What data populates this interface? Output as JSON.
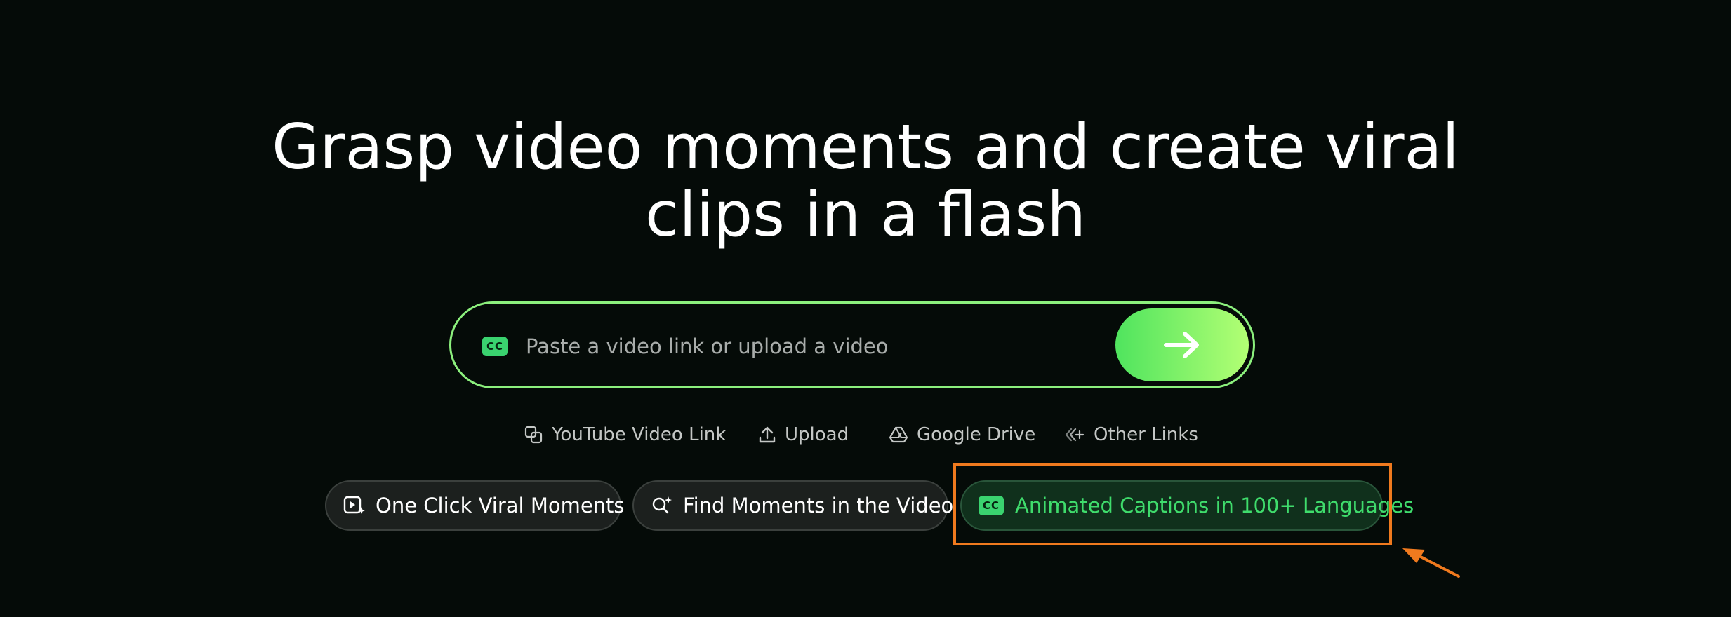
{
  "hero": {
    "title_line1": "Grasp video moments and create viral",
    "title_line2": "clips in a flash"
  },
  "search": {
    "badge_text": "CC",
    "placeholder": "Paste a video link or upload a video",
    "submit_icon": "arrow-right-icon"
  },
  "sources": [
    {
      "label": "YouTube Video Link",
      "icon": "link-copy-icon"
    },
    {
      "label": "Upload",
      "icon": "upload-icon"
    },
    {
      "label": "Google Drive",
      "icon": "google-drive-icon"
    },
    {
      "label": "Other Links",
      "icon": "other-links-icon"
    }
  ],
  "features": [
    {
      "label": "One Click Viral Moments",
      "icon": "play-sparkle-icon",
      "active": false
    },
    {
      "label": "Find Moments in the Video",
      "icon": "search-sparkle-icon",
      "active": false
    },
    {
      "label": "Animated Captions in 100+ Languages",
      "icon": "cc-icon",
      "badge_text": "CC",
      "active": true
    }
  ],
  "colors": {
    "background": "#050b08",
    "accent_green": "#3ad36f",
    "input_border": "#8cf07d",
    "annotation_orange": "#f07a1e"
  }
}
